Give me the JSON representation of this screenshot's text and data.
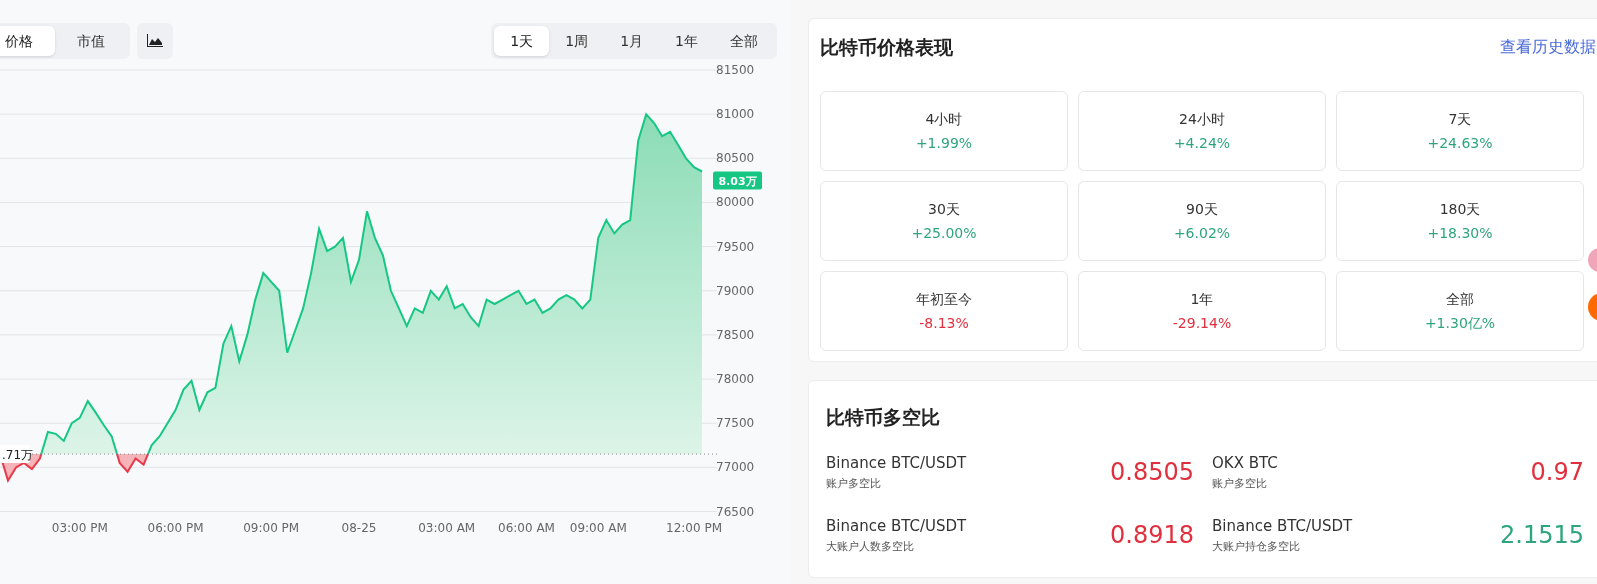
{
  "chart_panel": {
    "mode_tabs": [
      {
        "label": "价格",
        "selected": true
      },
      {
        "label": "市值",
        "selected": false
      }
    ],
    "range_tabs": [
      {
        "label": "1天",
        "selected": true
      },
      {
        "label": "1周",
        "selected": false
      },
      {
        "label": "1月",
        "selected": false
      },
      {
        "label": "1年",
        "selected": false
      },
      {
        "label": "全部",
        "selected": false
      }
    ],
    "chart_data": {
      "type": "area",
      "ylim": [
        76500,
        81500
      ],
      "yticks": [
        76500,
        77000,
        77500,
        78000,
        78500,
        79000,
        79500,
        80000,
        80500,
        81000,
        81500
      ],
      "categories": [
        null,
        null,
        null,
        null,
        null,
        null,
        null,
        null,
        null,
        null,
        "03:00 PM",
        null,
        null,
        null,
        null,
        null,
        null,
        null,
        null,
        null,
        null,
        null,
        "06:00 PM",
        null,
        null,
        null,
        null,
        null,
        null,
        null,
        null,
        null,
        null,
        null,
        "09:00 PM",
        null,
        null,
        null,
        null,
        null,
        null,
        null,
        null,
        null,
        null,
        "08-25",
        null,
        null,
        null,
        null,
        null,
        null,
        null,
        null,
        null,
        null,
        "03:00 AM",
        null,
        null,
        null,
        null,
        null,
        null,
        null,
        null,
        null,
        "06:00 AM",
        null,
        null,
        null,
        null,
        null,
        null,
        null,
        null,
        "09:00 AM",
        null,
        null,
        null,
        null,
        null,
        null,
        null,
        null,
        null,
        null,
        null,
        "12:00 PM",
        null
      ],
      "series": [
        {
          "color": "#16c784",
          "values": [
            77150,
            76850,
            77000,
            77050,
            76980,
            77100,
            77400,
            77380,
            77300,
            77500,
            77560,
            77750,
            77620,
            77480,
            77350,
            77050,
            76950,
            77100,
            77030,
            77250,
            77350,
            77500,
            77650,
            77880,
            77980,
            77650,
            77850,
            77900,
            78400,
            78600,
            78200,
            78500,
            78900,
            79200,
            79100,
            79000,
            78300,
            78550,
            78800,
            79200,
            79700,
            79450,
            79500,
            79600,
            79100,
            79350,
            79900,
            79600,
            79400,
            79000,
            78800,
            78600,
            78800,
            78750,
            79000,
            78900,
            79050,
            78800,
            78850,
            78700,
            78600,
            78900,
            78850,
            78900,
            78950,
            79000,
            78850,
            78900,
            78750,
            78800,
            78900,
            78950,
            78900,
            78800,
            78900,
            79600,
            79800,
            79650,
            79750,
            79800,
            80700,
            81000,
            80900,
            80750,
            80800,
            80650,
            80500,
            80400,
            80350
          ]
        }
      ],
      "grid": true,
      "ref_lines": [
        {
          "axis": "y",
          "value": 77150,
          "label": ".71万"
        }
      ],
      "annotations": [
        "8.03万"
      ]
    }
  },
  "performance": {
    "title": "比特币价格表现",
    "link": "查看历史数据",
    "periods": [
      {
        "label": "4小时",
        "change": "+1.99%",
        "color": "#2ea57e"
      },
      {
        "label": "24小时",
        "change": "+4.24%",
        "color": "#2ea57e"
      },
      {
        "label": "7天",
        "change": "+24.63%",
        "color": "#2ea57e"
      },
      {
        "label": "30天",
        "change": "+25.00%",
        "color": "#2ea57e"
      },
      {
        "label": "90天",
        "change": "+6.02%",
        "color": "#2ea57e"
      },
      {
        "label": "180天",
        "change": "+18.30%",
        "color": "#2ea57e"
      },
      {
        "label": "年初至今",
        "change": "-8.13%",
        "color": "#e0303d"
      },
      {
        "label": "1年",
        "change": "-29.14%",
        "color": "#e0303d"
      },
      {
        "label": "全部",
        "change": "+1.30亿%",
        "color": "#2ea57e"
      }
    ]
  },
  "long_short": {
    "title": "比特币多空比",
    "items": [
      {
        "exchange": "Binance BTC/USDT",
        "metric": "账户多空比",
        "value": "0.8505",
        "color": "#e0303d"
      },
      {
        "exchange": "OKX BTC",
        "metric": "账户多空比",
        "value": "0.97",
        "color": "#e0303d"
      },
      {
        "exchange": "Binance BTC/USDT",
        "metric": "大账户人数多空比",
        "value": "0.8918",
        "color": "#e0303d"
      },
      {
        "exchange": "Binance BTC/USDT",
        "metric": "大账户持仓多空比",
        "value": "2.1515",
        "color": "#2ea57e"
      }
    ]
  }
}
